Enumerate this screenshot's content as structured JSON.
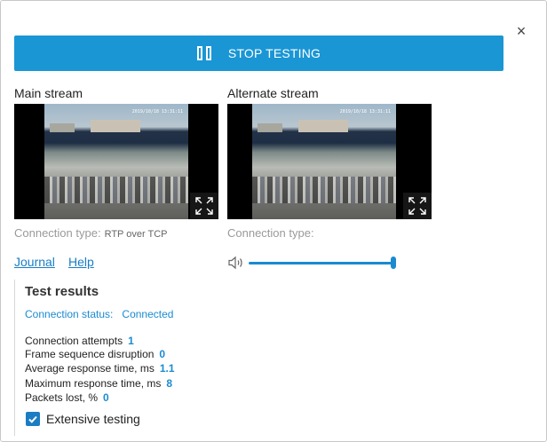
{
  "dialog": {
    "close_glyph": "×"
  },
  "toolbar": {
    "stop_label": "STOP TESTING"
  },
  "streams": {
    "main": {
      "title": "Main stream",
      "connection_type_label": "Connection type:",
      "connection_type_value": "RTP over TCP",
      "timestamp": "2019/10/18 13:31:11"
    },
    "alternate": {
      "title": "Alternate stream",
      "connection_type_label": "Connection type:",
      "connection_type_value": "",
      "timestamp": "2019/10/18 13:31:11"
    }
  },
  "links": {
    "journal": "Journal",
    "help": "Help"
  },
  "volume": {
    "level": 1.0,
    "icon": "speaker-icon"
  },
  "results": {
    "title": "Test results",
    "status_label": "Connection status:",
    "status_value": "Connected",
    "stats": [
      {
        "label": "Connection attempts",
        "value": "1"
      },
      {
        "label": "Frame sequence disruption",
        "value": "0"
      },
      {
        "label": "Average response time, ms",
        "value": "1.1"
      },
      {
        "label": "Maximum response time, ms",
        "value": "8"
      },
      {
        "label": "Packets lost, %",
        "value": "0"
      }
    ],
    "extensive_label": "Extensive testing",
    "extensive_checked": true
  },
  "colors": {
    "accent": "#1a96d4",
    "link": "#1a7dc4"
  }
}
